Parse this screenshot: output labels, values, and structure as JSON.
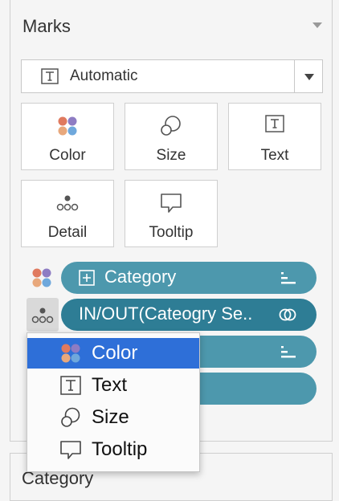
{
  "marks": {
    "title": "Marks",
    "mark_type": "Automatic",
    "cards": [
      {
        "label": "Color"
      },
      {
        "label": "Size"
      },
      {
        "label": "Text"
      },
      {
        "label": "Detail"
      },
      {
        "label": "Tooltip"
      }
    ],
    "pills": [
      {
        "label": "Category"
      },
      {
        "label": "IN/OUT(Cateogry Se.."
      },
      {
        "label": ""
      },
      {
        "label": ""
      }
    ]
  },
  "context_menu": {
    "items": [
      {
        "label": "Color",
        "selected": true
      },
      {
        "label": "Text",
        "selected": false
      },
      {
        "label": "Size",
        "selected": false
      },
      {
        "label": "Tooltip",
        "selected": false
      }
    ]
  },
  "filters_panel": {
    "label": "Category"
  },
  "colors": {
    "pill": "#4d98ad",
    "pill_active": "#2e7d95",
    "menu_selected": "#2e6fd8",
    "dot_colors": [
      "#e07a5f",
      "#8e7cc3",
      "#e8a87c",
      "#6fa8dc"
    ]
  }
}
